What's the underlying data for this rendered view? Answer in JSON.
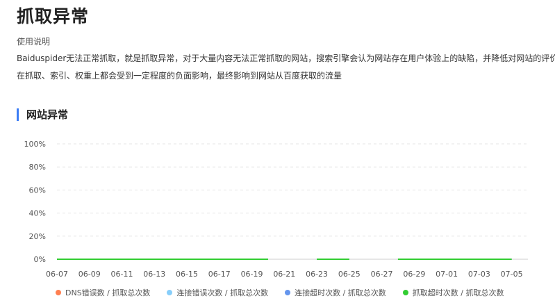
{
  "page": {
    "title": "抓取异常",
    "usage_heading": "使用说明",
    "usage_text": "Baiduspider无法正常抓取，就是抓取异常，对于大量内容无法正常抓取的网站，搜索引擎会认为网站存在用户体验上的缺陷，并降低对网站的评价，在抓取、索引、权重上都会受到一定程度的负面影响，最终影响到网站从百度获取的流量"
  },
  "section": {
    "title": "网站异常"
  },
  "colors": {
    "grid": "#e4e4e4",
    "axis": "#cccccc",
    "series": [
      "#ff7f50",
      "#87cefa",
      "#6495ed",
      "#32cd32"
    ]
  },
  "chart_data": {
    "type": "line",
    "title": "",
    "xlabel": "",
    "ylabel": "",
    "y_ticks": [
      "0%",
      "20%",
      "40%",
      "60%",
      "80%",
      "100%"
    ],
    "ylim": [
      0,
      100
    ],
    "grid": "horizontal dashed",
    "legend_position": "bottom",
    "x_tick_labels": [
      "06-07",
      "06-09",
      "06-11",
      "06-13",
      "06-15",
      "06-17",
      "06-19",
      "06-21",
      "06-23",
      "06-25",
      "06-27",
      "06-29",
      "07-01",
      "07-03",
      "07-05"
    ],
    "x": [
      "06-07",
      "06-08",
      "06-09",
      "06-10",
      "06-11",
      "06-12",
      "06-13",
      "06-14",
      "06-15",
      "06-16",
      "06-17",
      "06-18",
      "06-19",
      "06-20",
      "06-21",
      "06-22",
      "06-23",
      "06-24",
      "06-25",
      "06-26",
      "06-27",
      "06-28",
      "06-29",
      "06-30",
      "07-01",
      "07-02",
      "07-03",
      "07-04",
      "07-05",
      "07-06"
    ],
    "series": [
      {
        "name": "DNS错误数 / 抓取总次数",
        "values": [
          0,
          0,
          0,
          0,
          0,
          0,
          0,
          0,
          0,
          0,
          0,
          0,
          0,
          0,
          null,
          null,
          0,
          0,
          0,
          null,
          null,
          0,
          0,
          0,
          0,
          0,
          0,
          0,
          0,
          null
        ]
      },
      {
        "name": "连接错误次数 / 抓取总次数",
        "values": [
          0,
          0,
          0,
          0,
          0,
          0,
          0,
          0,
          0,
          0,
          0,
          0,
          0,
          0,
          null,
          null,
          0,
          0,
          0,
          null,
          null,
          0,
          0,
          0,
          0,
          0,
          0,
          0,
          0,
          null
        ]
      },
      {
        "name": "连接超时次数 / 抓取总次数",
        "values": [
          0,
          0,
          0,
          0,
          0,
          0,
          0,
          0,
          0,
          0,
          0,
          0,
          0,
          0,
          null,
          null,
          0,
          0,
          0,
          null,
          null,
          0,
          0,
          0,
          0,
          0,
          0,
          0,
          0,
          null
        ]
      },
      {
        "name": "抓取超时次数 / 抓取总次数",
        "values": [
          0,
          0,
          0,
          0,
          0,
          0,
          0,
          0,
          0,
          0,
          0,
          0,
          0,
          0,
          null,
          null,
          0,
          0,
          0,
          null,
          null,
          0,
          0,
          0,
          0,
          0,
          0,
          0,
          0,
          null
        ]
      }
    ]
  }
}
